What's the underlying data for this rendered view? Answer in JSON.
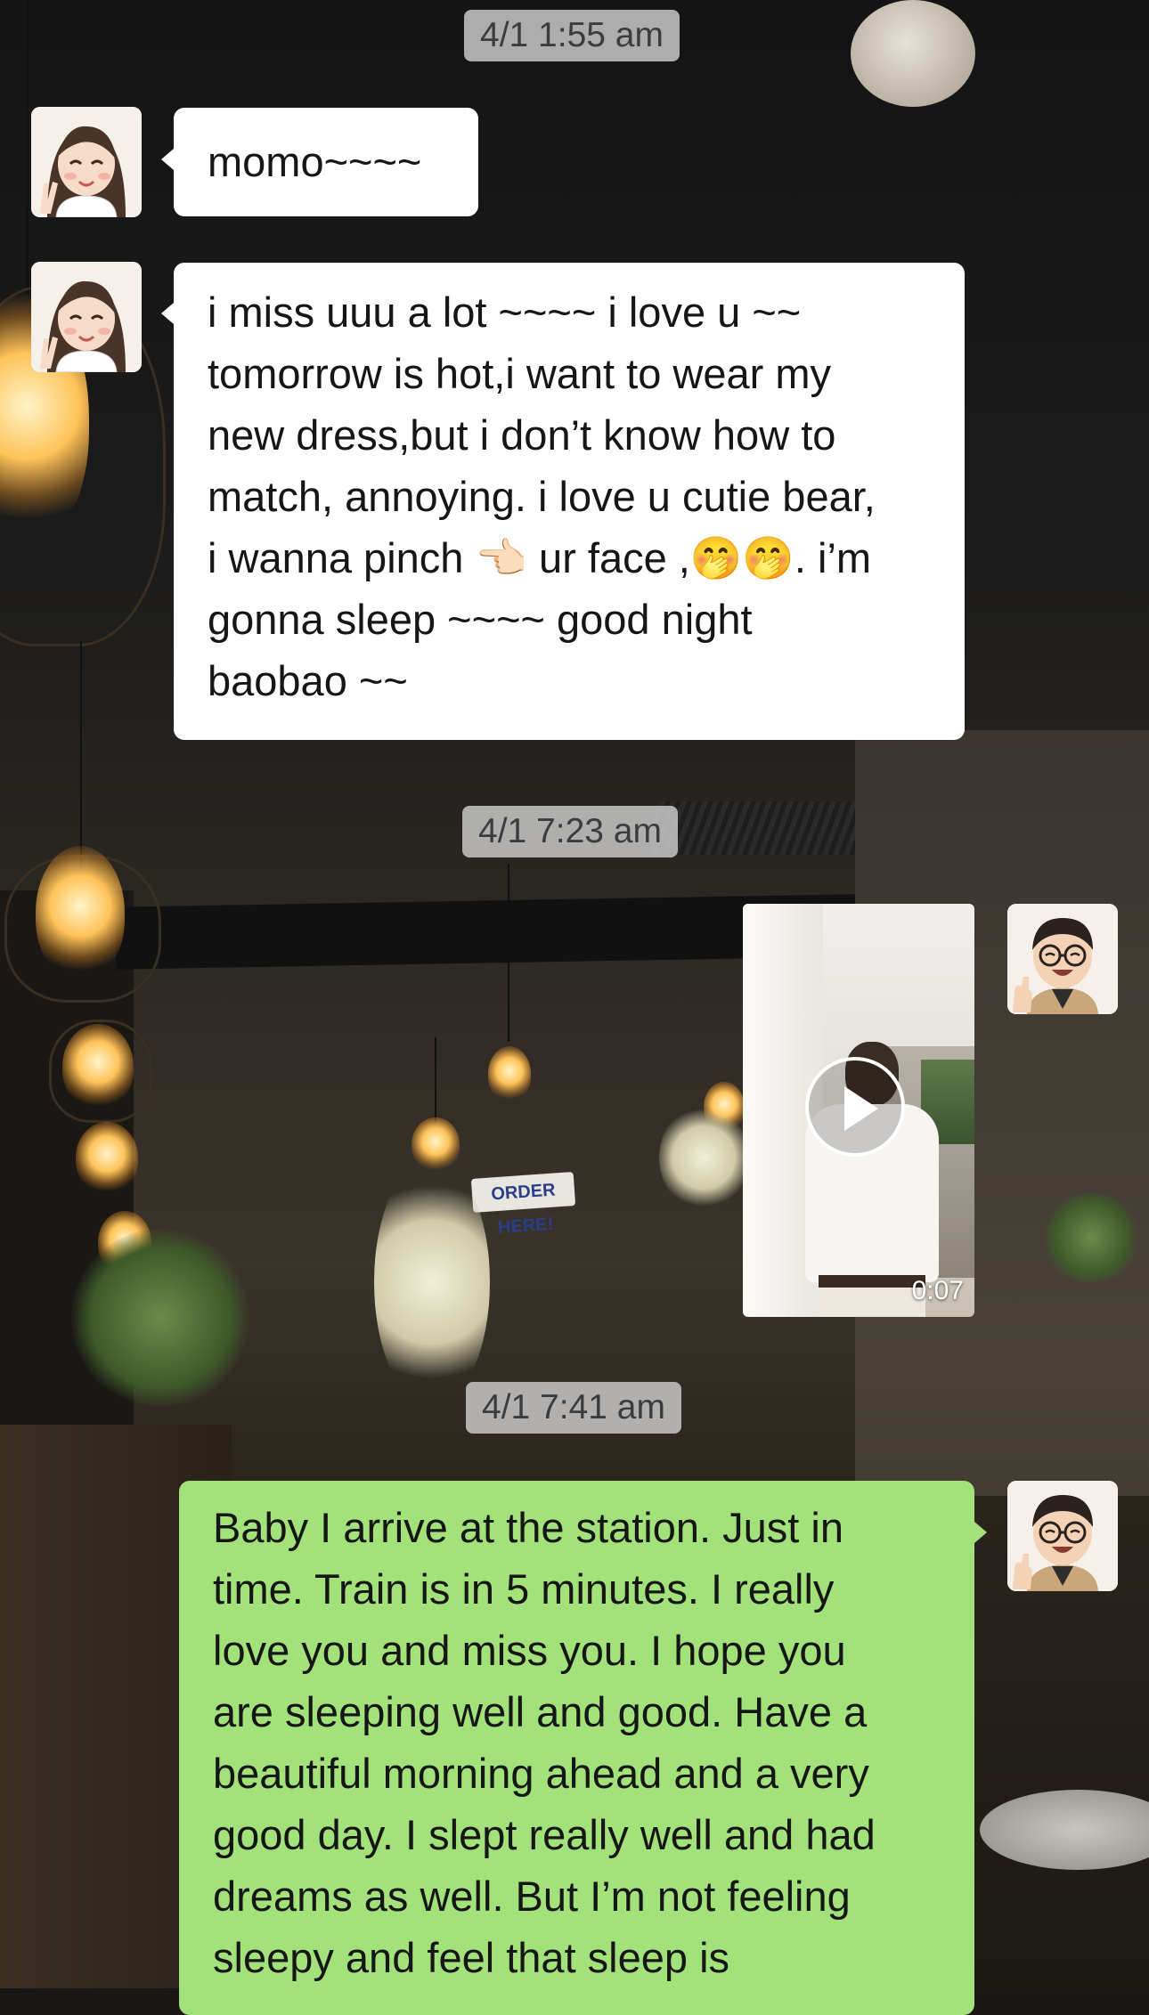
{
  "timestamps": [
    "4/1 1:55 am",
    "4/1 7:23 am",
    "4/1 7:41 am"
  ],
  "messages": [
    {
      "sender": "her",
      "type": "text",
      "text": "momo~~~~"
    },
    {
      "sender": "her",
      "type": "text",
      "lines": [
        "i miss uuu a lot ~~~~ i love u ~~",
        "tomorrow is hot,i want to wear my",
        "new dress,but i don’t know how to",
        "match, annoying. i love u cutie bear,",
        "i wanna pinch 👈🏻 ur face ,🤭🤭. i’m",
        "gonna sleep ~~~~ good night",
        "baobao ~~"
      ]
    },
    {
      "sender": "me",
      "type": "video",
      "duration": "0:07"
    },
    {
      "sender": "me",
      "type": "text",
      "lines": [
        "Baby I arrive at the station. Just in",
        "time. Train is in 5 minutes. I really",
        "love you and miss you. I hope you",
        "are sleeping well and good. Have a",
        "beautiful morning ahead and a very",
        "good day. I slept really well and had",
        "dreams as well. But I’m not feeling",
        "sleepy and feel that sleep is"
      ]
    }
  ],
  "background": {
    "sign_text": "ORDER HERE!"
  },
  "colors": {
    "incoming_bubble": "#ffffff",
    "outgoing_bubble": "#a3e27b",
    "timestamp_pill": "#c8c8c8"
  },
  "avatars": {
    "her": "girl-avatar",
    "me": "guy-avatar"
  }
}
